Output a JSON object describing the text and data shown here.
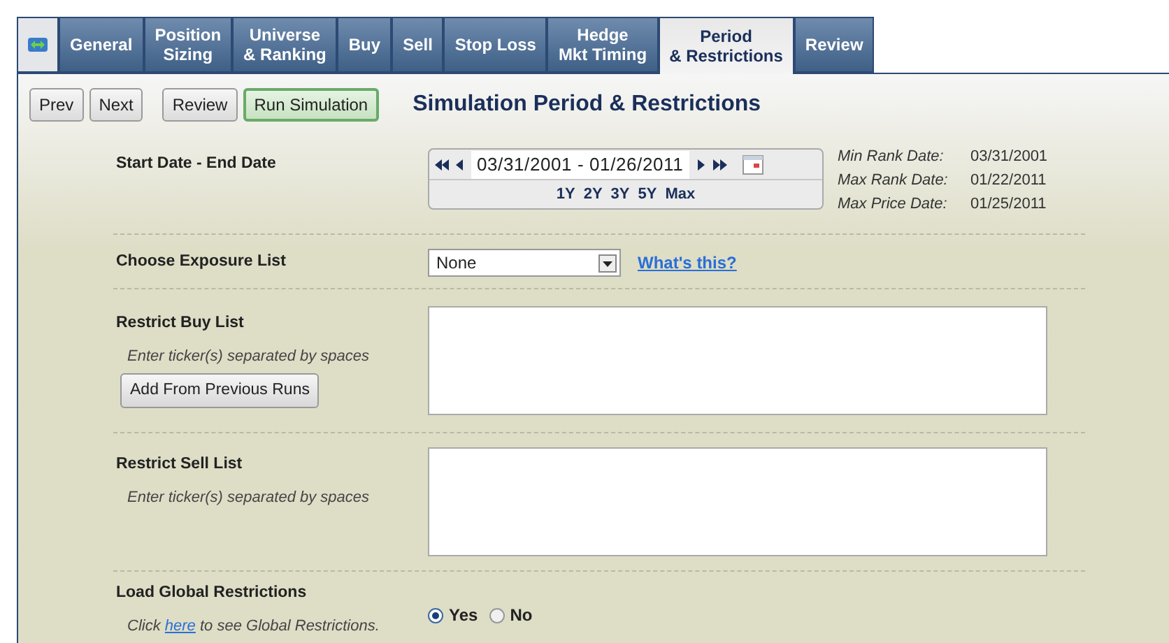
{
  "tabs": [
    {
      "kind": "icon",
      "selected": false
    },
    {
      "kind": "text",
      "label": "General",
      "selected": false
    },
    {
      "kind": "text",
      "label": "Position\nSizing",
      "selected": false
    },
    {
      "kind": "text",
      "label": "Universe\n& Ranking",
      "selected": false
    },
    {
      "kind": "text",
      "label": "Buy",
      "selected": false
    },
    {
      "kind": "text",
      "label": "Sell",
      "selected": false
    },
    {
      "kind": "text",
      "label": "Stop Loss",
      "selected": false
    },
    {
      "kind": "text",
      "label": "Hedge\nMkt Timing",
      "selected": false
    },
    {
      "kind": "text",
      "label": "Period\n& Restrictions",
      "selected": true
    },
    {
      "kind": "text",
      "label": "Review",
      "selected": false
    }
  ],
  "toolbar": [
    {
      "label": "Prev",
      "kind": "plain"
    },
    {
      "label": "Next",
      "kind": "plain"
    },
    {
      "label": "Review",
      "kind": "plain",
      "gap": true
    },
    {
      "label": "Run Simulation",
      "kind": "primary"
    }
  ],
  "title": "Simulation Period & Restrictions",
  "date_range": {
    "label": "Start Date - End Date",
    "value": "03/31/2001 - 01/26/2011",
    "presets": [
      "1Y",
      "2Y",
      "3Y",
      "5Y",
      "Max"
    ],
    "info": [
      {
        "name": "Min Rank Date:",
        "value": "03/31/2001"
      },
      {
        "name": "Max Rank Date:",
        "value": "01/22/2011"
      },
      {
        "name": "Max Price Date:",
        "value": "01/25/2011"
      }
    ]
  },
  "exposure": {
    "label": "Choose Exposure List",
    "value": "None",
    "help_link": "What's this?"
  },
  "buy_list": {
    "label": "Restrict Buy List",
    "hint": "Enter ticker(s) separated by spaces",
    "button": "Add From Previous Runs"
  },
  "sell_list": {
    "label": "Restrict Sell List",
    "hint": "Enter ticker(s) separated by spaces"
  },
  "global": {
    "label": "Load Global Restrictions",
    "hint_before": "Click",
    "hint_link": "here",
    "hint_after": "to see Global Restrictions.",
    "options": [
      {
        "label": "Yes",
        "selected": true
      },
      {
        "label": "No",
        "selected": false
      }
    ]
  }
}
